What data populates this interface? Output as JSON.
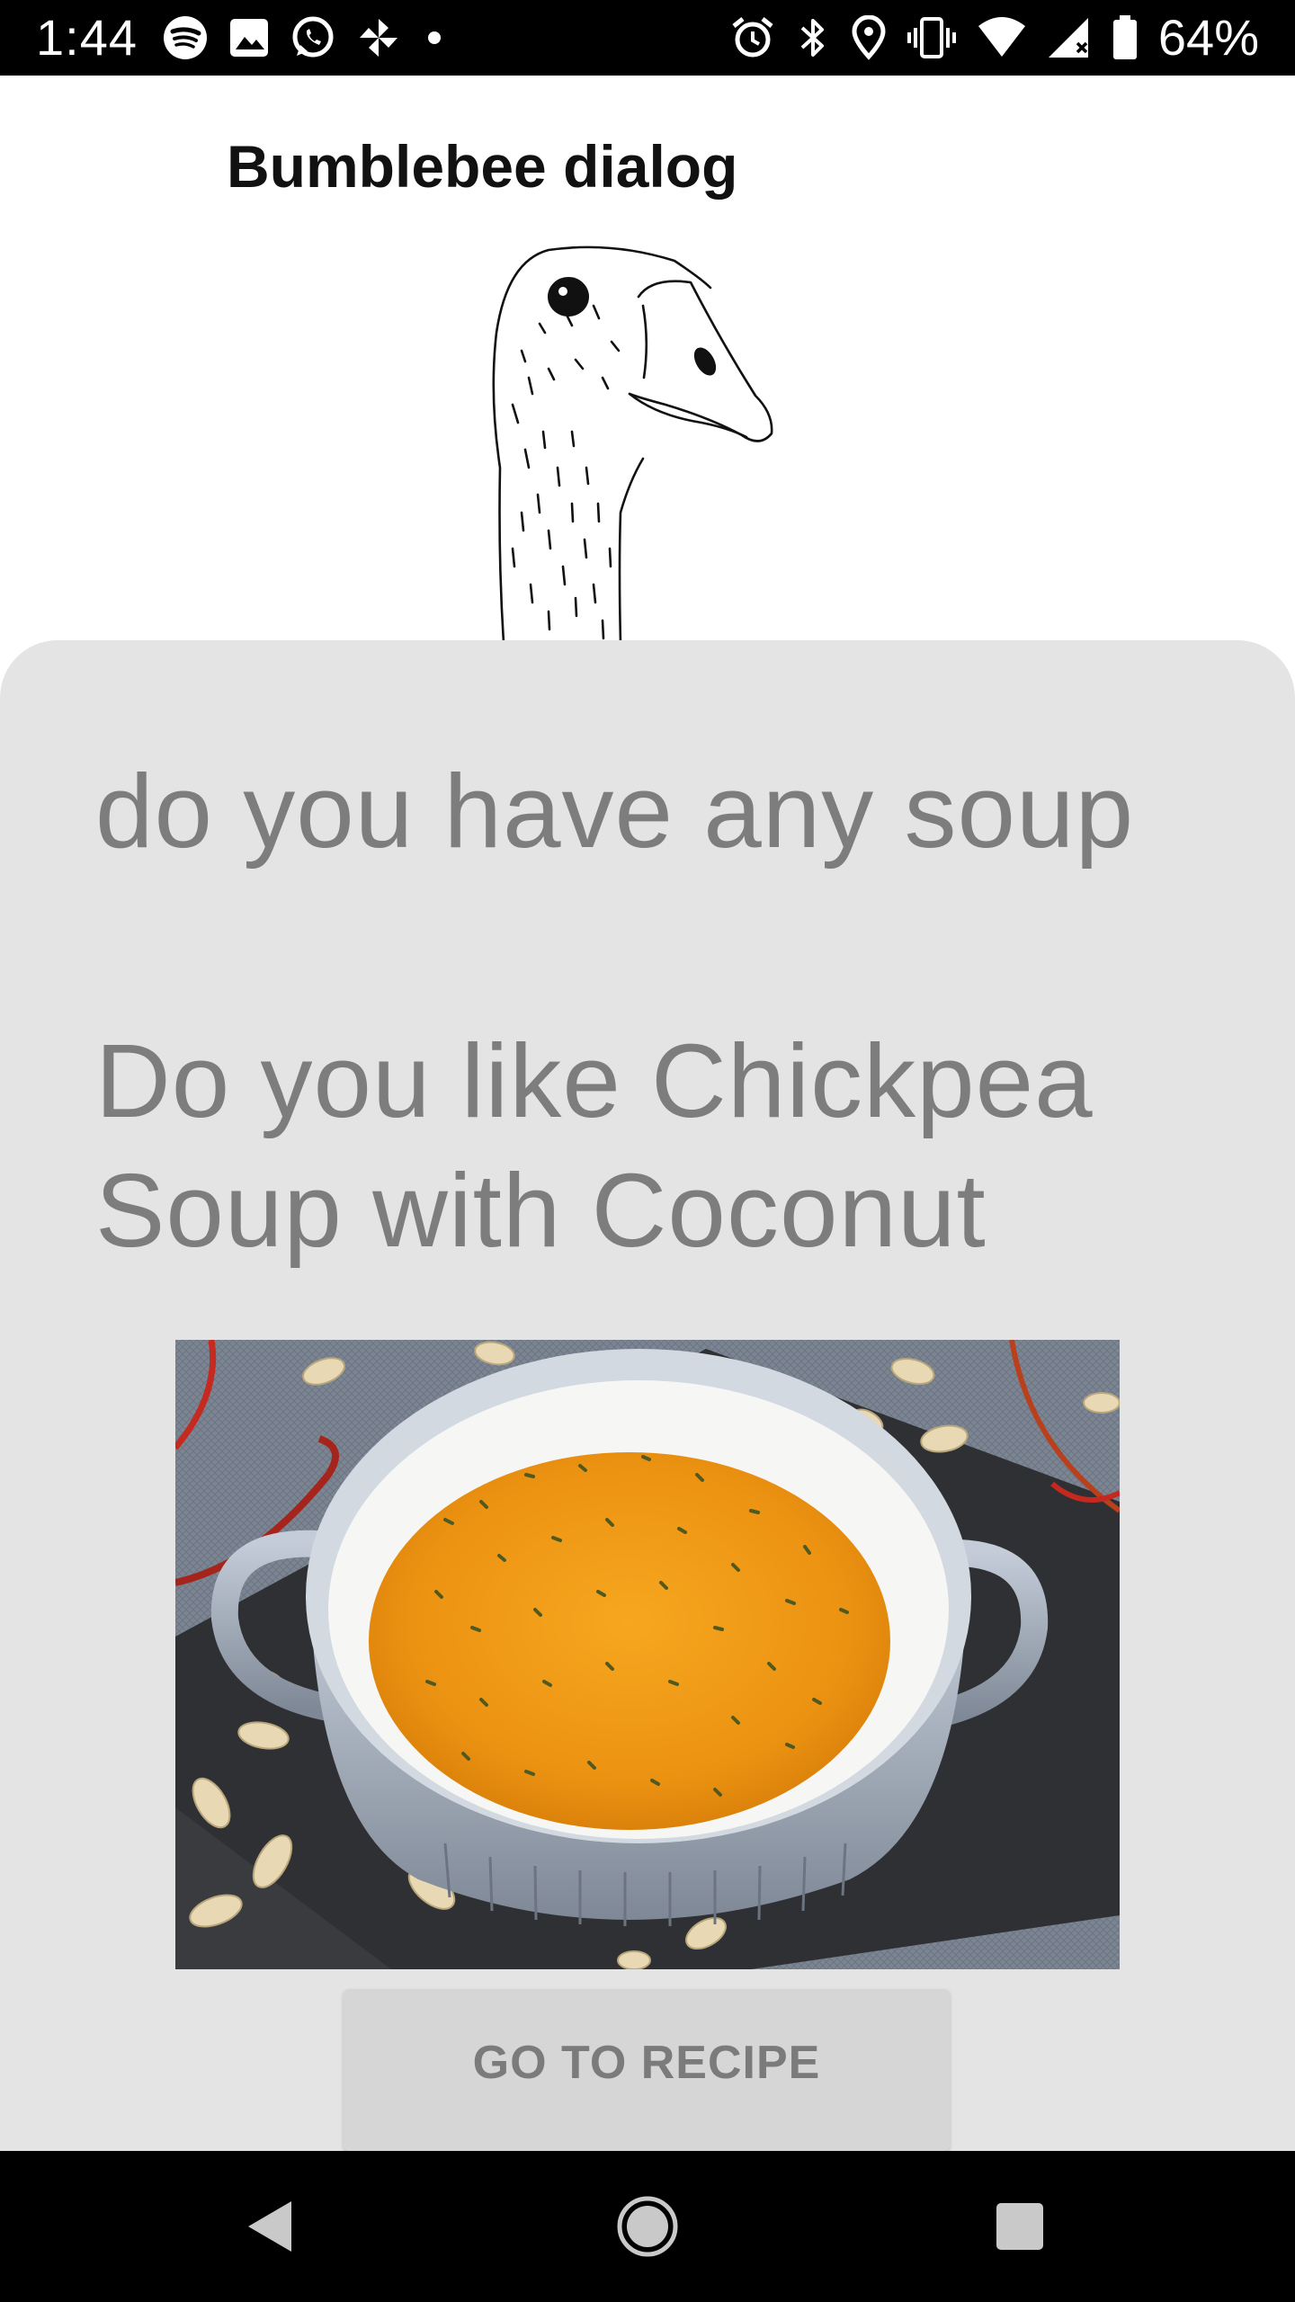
{
  "status_bar": {
    "time": "1:44",
    "battery_percent": "64%",
    "left_icons": [
      "spotify-icon",
      "gallery-icon",
      "whatsapp-icon",
      "pinwheel-icon",
      "dot-icon"
    ],
    "right_icons": [
      "alarm-icon",
      "bluetooth-icon",
      "location-icon",
      "vibrate-icon",
      "wifi-icon",
      "cell-signal-icon",
      "battery-icon"
    ]
  },
  "dialog": {
    "title": "Bumblebee dialog",
    "illustration": "goose-illustration"
  },
  "conversation": {
    "user_message": "do you have any soup",
    "bot_reply": "Do you like Chickpea Soup with Coconut",
    "image": "soup-bowl-photo"
  },
  "actions": {
    "recipe_button_label": "GO TO RECIPE"
  },
  "nav_bar": {
    "buttons": [
      "back",
      "home",
      "recents"
    ]
  },
  "colors": {
    "sheet_background": "#e4e4e4",
    "message_text": "#7d7d7d",
    "button_background": "#d6d6d6",
    "soup": "#f0a01a"
  }
}
